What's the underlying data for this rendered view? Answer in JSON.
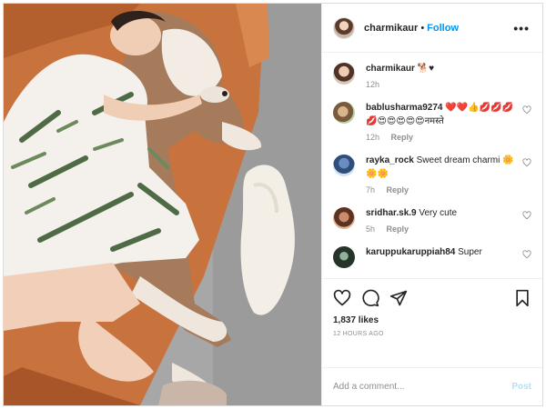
{
  "header": {
    "username": "charmikaur",
    "separator": "•",
    "follow_label": "Follow",
    "more_label": "•••"
  },
  "caption": {
    "username": "charmikaur",
    "text": "🐕♥",
    "time": "12h"
  },
  "comments": [
    {
      "username": "bablusharma9274",
      "text": "❤️❤️👍💋💋💋💋😍😍😍😍😍नमस्ते",
      "time": "12h",
      "reply_label": "Reply"
    },
    {
      "username": "rayka_rock",
      "text": "Sweet dream charmi 🌼🌼🌼",
      "time": "7h",
      "reply_label": "Reply"
    },
    {
      "username": "sridhar.sk.9",
      "text": "Very cute",
      "time": "5h",
      "reply_label": "Reply"
    },
    {
      "username": "karuppukaruppiah84",
      "text": "Super",
      "time": "",
      "reply_label": ""
    }
  ],
  "stats": {
    "likes": "1,837 likes",
    "posted": "12 HOURS AGO"
  },
  "add_comment": {
    "placeholder": "Add a comment...",
    "post_label": "Post"
  },
  "icons": {
    "like": "heart-icon",
    "comment": "comment-bubble-icon",
    "share": "paper-plane-icon",
    "save": "bookmark-icon",
    "more": "ellipsis-icon"
  },
  "colors": {
    "accent": "#0095f6",
    "post_disabled": "#b2dffc",
    "muted": "#8e8e8e",
    "sofa": "#c8733e"
  }
}
